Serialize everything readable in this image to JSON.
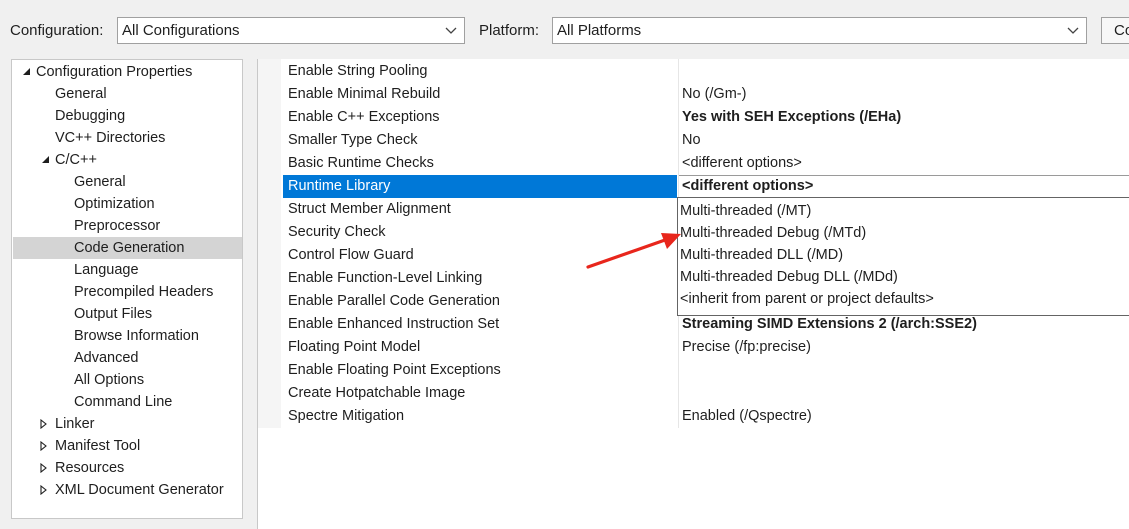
{
  "toolbar": {
    "configuration_label": "Configuration:",
    "configuration_value": "All Configurations",
    "platform_label": "Platform:",
    "platform_value": "All Platforms",
    "right_button_text": "Co"
  },
  "tree": {
    "items": [
      {
        "label": "Configuration Properties",
        "expanded": true,
        "icon": "triangle-expanded-icon"
      },
      {
        "label": "General"
      },
      {
        "label": "Debugging"
      },
      {
        "label": "VC++ Directories"
      },
      {
        "label": "C/C++",
        "expanded": true,
        "icon": "triangle-expanded-icon"
      },
      {
        "label": "General"
      },
      {
        "label": "Optimization"
      },
      {
        "label": "Preprocessor"
      },
      {
        "label": "Code Generation",
        "selected": true
      },
      {
        "label": "Language"
      },
      {
        "label": "Precompiled Headers"
      },
      {
        "label": "Output Files"
      },
      {
        "label": "Browse Information"
      },
      {
        "label": "Advanced"
      },
      {
        "label": "All Options"
      },
      {
        "label": "Command Line"
      },
      {
        "label": "Linker",
        "expanded": false,
        "icon": "triangle-collapsed-icon"
      },
      {
        "label": "Manifest Tool",
        "expanded": false,
        "icon": "triangle-collapsed-icon"
      },
      {
        "label": "Resources",
        "expanded": false,
        "icon": "triangle-collapsed-icon"
      },
      {
        "label": "XML Document Generator",
        "expanded": false,
        "icon": "triangle-collapsed-icon"
      }
    ]
  },
  "grid": {
    "rows": [
      {
        "name": "Enable String Pooling",
        "value": "",
        "bold": false
      },
      {
        "name": "Enable Minimal Rebuild",
        "value": "No (/Gm-)",
        "bold": false
      },
      {
        "name": "Enable C++ Exceptions",
        "value": "Yes with SEH Exceptions (/EHa)",
        "bold": true
      },
      {
        "name": "Smaller Type Check",
        "value": "No",
        "bold": false
      },
      {
        "name": "Basic Runtime Checks",
        "value": "<different options>",
        "bold": false
      },
      {
        "name": "Runtime Library",
        "value": "<different options>",
        "bold": true,
        "selected": true
      },
      {
        "name": "Struct Member Alignment",
        "value": "",
        "bold": false
      },
      {
        "name": "Security Check",
        "value": "",
        "bold": false
      },
      {
        "name": "Control Flow Guard",
        "value": "",
        "bold": false
      },
      {
        "name": "Enable Function-Level Linking",
        "value": "",
        "bold": false
      },
      {
        "name": "Enable Parallel Code Generation",
        "value": "",
        "bold": false
      },
      {
        "name": "Enable Enhanced Instruction Set",
        "value": "Streaming SIMD Extensions 2 (/arch:SSE2)",
        "bold": true
      },
      {
        "name": "Floating Point Model",
        "value": "Precise (/fp:precise)",
        "bold": false
      },
      {
        "name": "Enable Floating Point Exceptions",
        "value": "",
        "bold": false
      },
      {
        "name": "Create Hotpatchable Image",
        "value": "",
        "bold": false
      },
      {
        "name": "Spectre Mitigation",
        "value": "Enabled (/Qspectre)",
        "bold": false
      }
    ]
  },
  "dropdown": {
    "options": [
      "Multi-threaded (/MT)",
      "Multi-threaded Debug (/MTd)",
      "Multi-threaded DLL (/MD)",
      "Multi-threaded Debug DLL (/MDd)",
      "<inherit from parent or project defaults>"
    ]
  },
  "colors": {
    "selection": "#0078d7",
    "tree_selection": "#d4d4d4",
    "annotation_arrow": "#e8261c"
  }
}
